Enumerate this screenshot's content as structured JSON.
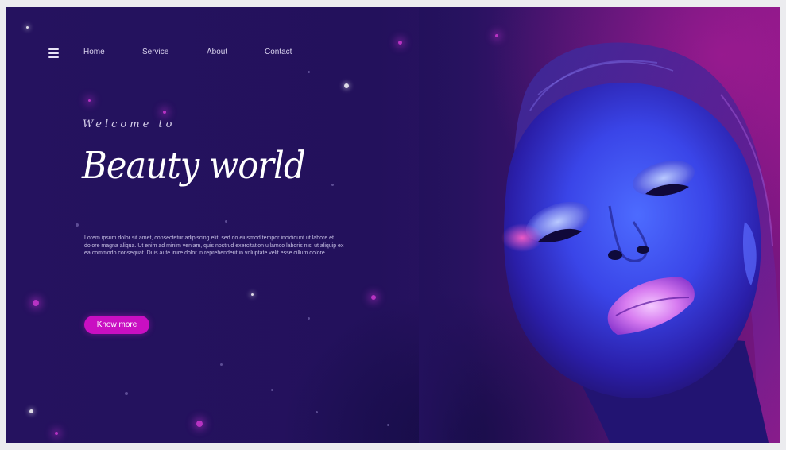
{
  "nav": {
    "menu_icon": "hamburger-menu-icon",
    "links": [
      "Home",
      "Service",
      "About",
      "Contact"
    ]
  },
  "hero": {
    "welcome": "Welcome to",
    "headline": "Beauty world",
    "body": "Lorem ipsum dolor sit amet, consectetur adipiscing elit, sed do eiusmod tempor incididunt ut labore et dolore magna aliqua. Ut enim ad minim veniam, quis nostrud exercitation ullamco laboris nisi ut aliquip ex ea commodo consequat. Duis aute irure dolor in reprehenderit in voluptate velit esse cillum dolore.",
    "cta_label": "Know more"
  },
  "colors": {
    "background": "#24125e",
    "accent": "#c90fc2",
    "text": "#d9d3ee"
  }
}
